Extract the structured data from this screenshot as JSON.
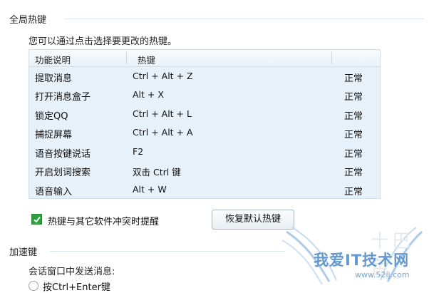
{
  "global_hotkeys": {
    "section_title": "全局热键",
    "description": "您可以通过点击选择要更改的热键。",
    "columns": [
      "功能说明",
      "热键",
      ""
    ],
    "rows": [
      {
        "function": "提取消息",
        "hotkey": "Ctrl + Alt + Z",
        "status": "正常"
      },
      {
        "function": "打开消息盒子",
        "hotkey": "Alt + X",
        "status": "正常"
      },
      {
        "function": "锁定QQ",
        "hotkey": "Ctrl + Alt + L",
        "status": "正常"
      },
      {
        "function": "捕捉屏幕",
        "hotkey": "Ctrl + Alt + A",
        "status": "正常"
      },
      {
        "function": "语音按键说话",
        "hotkey": "F2",
        "status": "正常"
      },
      {
        "function": "开启划词搜索",
        "hotkey": "双击 Ctrl 键",
        "status": "正常"
      },
      {
        "function": "语音输入",
        "hotkey": "Alt + W",
        "status": "正常"
      }
    ],
    "conflict_checkbox_label": "热键与其它软件冲突时提醒",
    "conflict_checkbox_checked": true,
    "restore_button_label": "恢复默认热键"
  },
  "accelerator": {
    "section_title": "加速键",
    "description": "会话窗口中发送消息:",
    "radio_partial_label": "按Ctrl+Enter键"
  },
  "watermark": {
    "main_text": "我爱IT技术网",
    "url_text": "www.52ij.com",
    "top_text": "十巴色"
  },
  "colors": {
    "table_bg": "#e7f1f9",
    "check_green": "#2e9e3f",
    "watermark_blue": "#4a88c8"
  }
}
